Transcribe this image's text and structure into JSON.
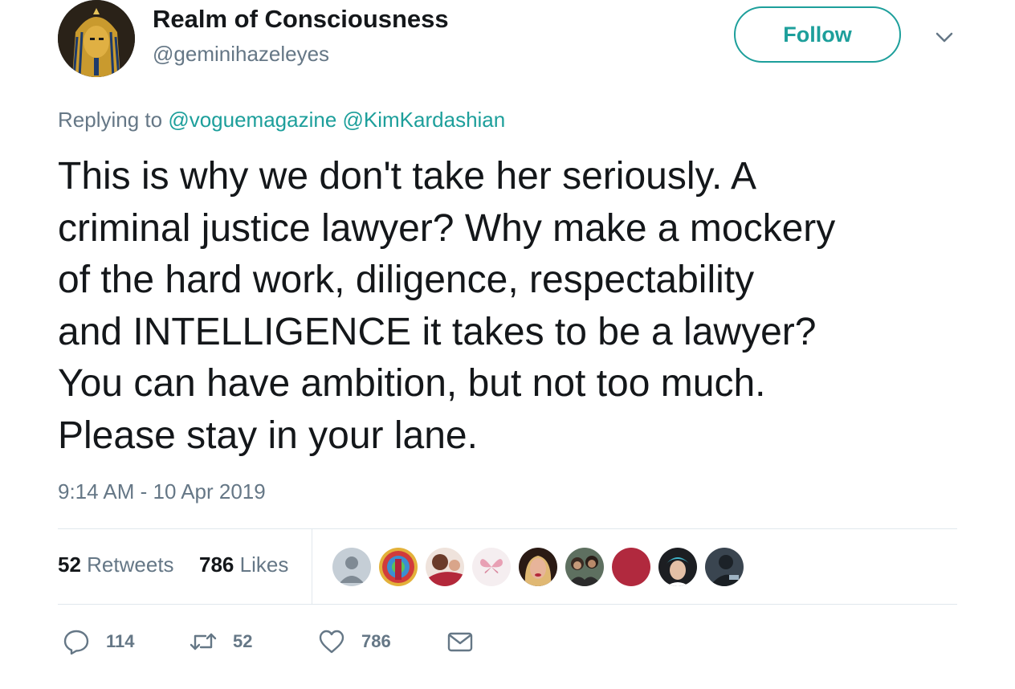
{
  "author": {
    "display_name": "Realm of Consciousness",
    "handle": "@geminihazeleyes",
    "avatar_icon": "golden-pharaoh-mask-icon"
  },
  "header": {
    "follow_label": "Follow",
    "more_icon": "chevron-down-icon"
  },
  "reply": {
    "prefix": "Replying to",
    "mentions": [
      "@voguemagazine",
      "@KimKardashian"
    ]
  },
  "tweet": {
    "lines": [
      "This is why we don't take her seriously. A",
      "criminal justice lawyer? Why make a mockery",
      "of the hard work, diligence, respectability",
      "and INTELLIGENCE it takes to be a lawyer?",
      "You can have ambition, but not too much.",
      "Please stay in your lane."
    ],
    "timestamp": "9:14 AM - 10 Apr 2019"
  },
  "stats": {
    "retweets_count": "52",
    "retweets_label": "Retweets",
    "likes_count": "786",
    "likes_label": "Likes"
  },
  "likers": [
    {
      "name": "default-avatar",
      "color": "#c5ced6"
    },
    {
      "name": "colorful-avatar",
      "color": "#d9a03b"
    },
    {
      "name": "photo-avatar",
      "color": "#8b3a3a"
    },
    {
      "name": "butterfly-avatar",
      "color": "#f2e6ea"
    },
    {
      "name": "blonde-avatar",
      "color": "#c98a6a"
    },
    {
      "name": "group-avatar",
      "color": "#4c5a4f"
    },
    {
      "name": "red-avatar",
      "color": "#b1293e"
    },
    {
      "name": "blue-hair-avatar",
      "color": "#2d2f33"
    },
    {
      "name": "dark-avatar",
      "color": "#2e3a45"
    }
  ],
  "actions": {
    "reply_count": "114",
    "retweet_count": "52",
    "like_count": "786"
  },
  "colors": {
    "accent": "#1d9f9b",
    "secondary_text": "#657786",
    "primary_text": "#14171a"
  }
}
